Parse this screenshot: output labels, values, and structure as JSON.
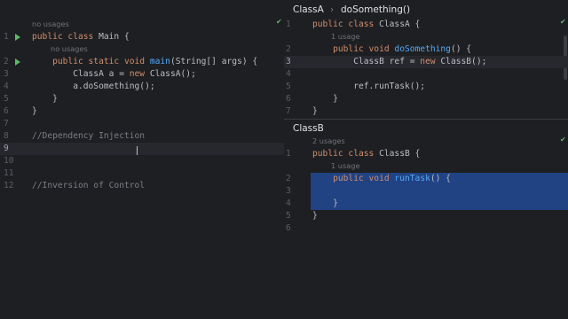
{
  "left_editor": {
    "lines": [
      {
        "n": "1",
        "hint_above": "no usages",
        "parts": [
          {
            "t": "public class ",
            "c": "kw"
          },
          {
            "t": "Main {",
            "c": ""
          }
        ]
      },
      {
        "n": "2",
        "hint_above": "no usages",
        "parts": [
          {
            "t": "    public static void ",
            "c": "kw"
          },
          {
            "t": "main",
            "c": "fn"
          },
          {
            "t": "(String[] args) {",
            "c": ""
          }
        ]
      },
      {
        "n": "3",
        "parts": [
          {
            "t": "        ClassA a = ",
            "c": ""
          },
          {
            "t": "new ",
            "c": "kw"
          },
          {
            "t": "ClassA();",
            "c": ""
          }
        ]
      },
      {
        "n": "4",
        "parts": [
          {
            "t": "        a.doSomething();",
            "c": ""
          }
        ]
      },
      {
        "n": "5",
        "parts": [
          {
            "t": "    }",
            "c": ""
          }
        ]
      },
      {
        "n": "6",
        "parts": [
          {
            "t": "}",
            "c": ""
          }
        ]
      },
      {
        "n": "7",
        "parts": []
      },
      {
        "n": "8",
        "parts": [
          {
            "t": "//Dependency Injection",
            "c": "cm"
          }
        ]
      },
      {
        "n": "9",
        "parts": []
      },
      {
        "n": "10",
        "parts": []
      },
      {
        "n": "11",
        "parts": []
      },
      {
        "n": "12",
        "parts": [
          {
            "t": "//Inversion of Control",
            "c": "cm"
          }
        ]
      }
    ],
    "current_line": "9",
    "run_icon_lines": [
      "1",
      "2"
    ]
  },
  "right_top": {
    "breadcrumb": {
      "class": "ClassA",
      "method": "doSomething()"
    },
    "lines": [
      {
        "n": "1",
        "parts": [
          {
            "t": "public class ",
            "c": "kw"
          },
          {
            "t": "ClassA {",
            "c": ""
          }
        ]
      },
      {
        "n": "2",
        "hint_above": "1 usage",
        "parts": [
          {
            "t": "    public void ",
            "c": "kw"
          },
          {
            "t": "doSomething",
            "c": "fn"
          },
          {
            "t": "() {",
            "c": ""
          }
        ]
      },
      {
        "n": "3",
        "parts": [
          {
            "t": "        ClassB ref = ",
            "c": ""
          },
          {
            "t": "new ",
            "c": "kw"
          },
          {
            "t": "ClassB();",
            "c": ""
          }
        ]
      },
      {
        "n": "4",
        "parts": []
      },
      {
        "n": "5",
        "parts": [
          {
            "t": "        ref.runTask();",
            "c": ""
          }
        ]
      },
      {
        "n": "6",
        "parts": [
          {
            "t": "    }",
            "c": ""
          }
        ]
      },
      {
        "n": "7",
        "parts": [
          {
            "t": "}",
            "c": ""
          }
        ]
      }
    ],
    "current_line": "3"
  },
  "right_bottom": {
    "title": "ClassB",
    "lines": [
      {
        "n": "1",
        "hint_above": "2 usages",
        "parts": [
          {
            "t": "public class ",
            "c": "kw"
          },
          {
            "t": "ClassB {",
            "c": ""
          }
        ]
      },
      {
        "n": "2",
        "hint_above": "1 usage",
        "parts": [
          {
            "t": "    public void ",
            "c": "kw"
          },
          {
            "t": "runTask",
            "c": "fn"
          },
          {
            "t": "() {",
            "c": ""
          }
        ]
      },
      {
        "n": "3",
        "parts": []
      },
      {
        "n": "4",
        "parts": [
          {
            "t": "    }",
            "c": ""
          }
        ]
      },
      {
        "n": "5",
        "parts": [
          {
            "t": "}",
            "c": ""
          }
        ]
      },
      {
        "n": "6",
        "parts": []
      }
    ]
  },
  "icons": {
    "run": "run-icon",
    "check": "check-icon"
  },
  "colors": {
    "background": "#1e1f22",
    "keyword": "#cf8e6d",
    "function": "#56a8f5",
    "comment": "#7a7e85",
    "selection": "#214283",
    "run": "#5fb865"
  }
}
